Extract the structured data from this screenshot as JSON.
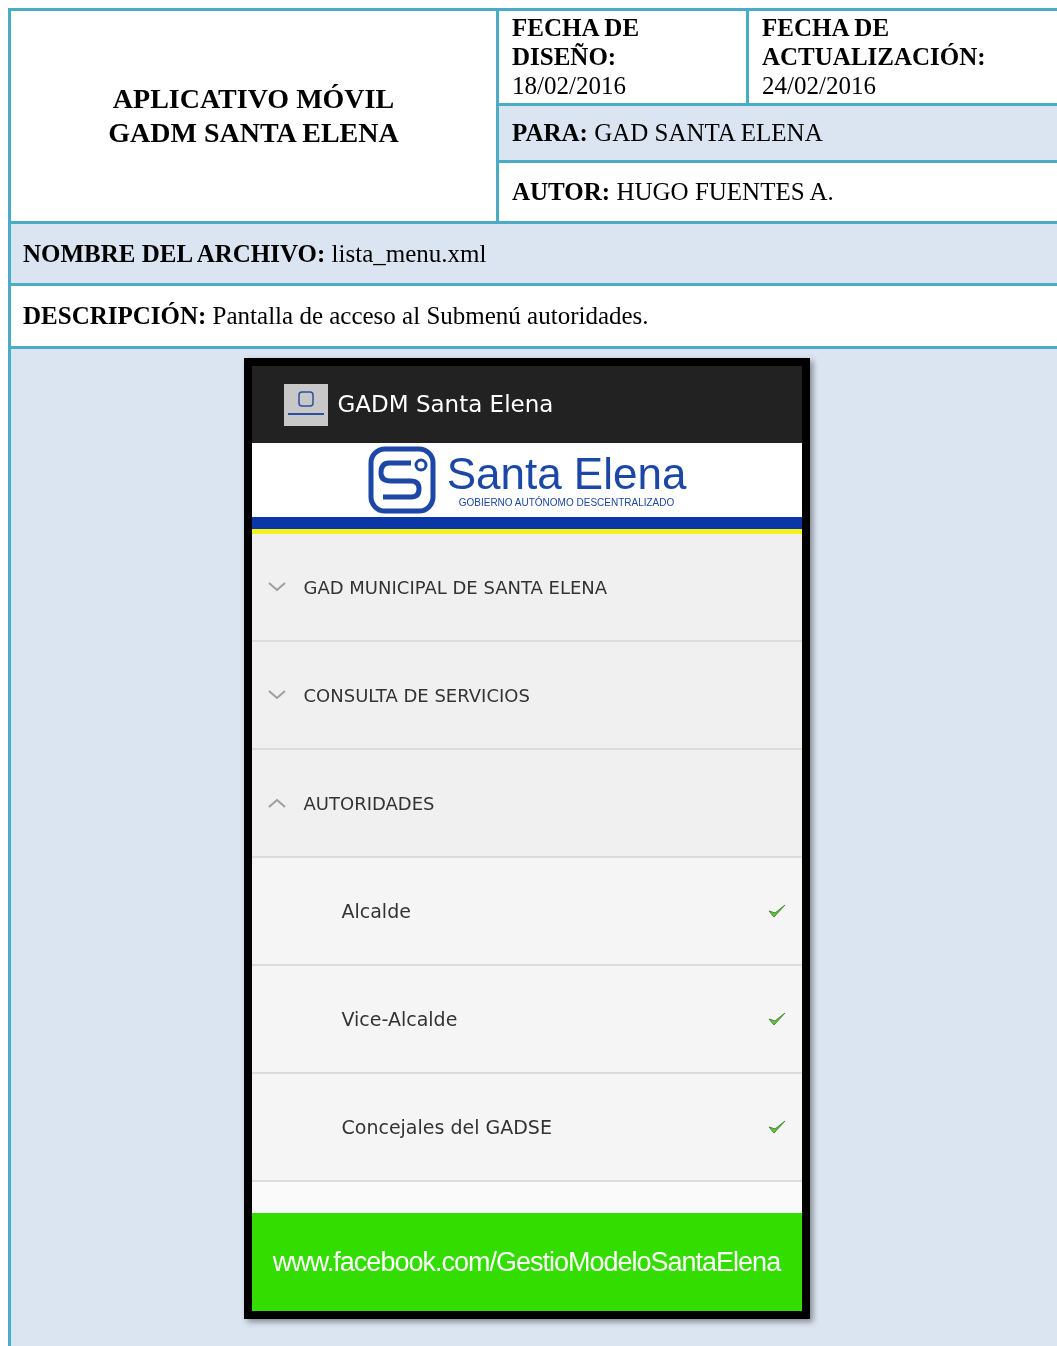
{
  "header": {
    "title_lines": [
      "APLICATIVO MÓVIL",
      "GADM SANTA ELENA"
    ],
    "design_date": {
      "label": "FECHA DE DISEÑO:",
      "value": "18/02/2016"
    },
    "update_date": {
      "label": "FECHA DE ACTUALIZACIÓN:",
      "value": "24/02/2016"
    },
    "for": "**PARA:** GAD SANTA ELENA",
    "author": "**AUTOR:** HUGO FUENTES A."
  },
  "file_name": "**NOMBRE DEL ARCHIVO:** lista_menu.xml",
  "description": "**DESCRIPCIÓN:** Pantalla de acceso al Submenú autoridades.",
  "app": {
    "title": "GADM Santa Elena",
    "logo": {
      "name": "Santa Elena",
      "subtitle": "GOBIERNO AUTÓNOMO DESCENTRALIZADO"
    },
    "menu": [
      {
        "label": "GAD MUNICIPAL DE SANTA ELENA",
        "expanded": false
      },
      {
        "label": "CONSULTA DE SERVICIOS",
        "expanded": false
      },
      {
        "label": "AUTORIDADES",
        "expanded": true,
        "children": [
          {
            "label": "Alcalde",
            "checked": true
          },
          {
            "label": "Vice-Alcalde",
            "checked": true
          },
          {
            "label": "Concejales del GADSE",
            "checked": true
          }
        ]
      }
    ],
    "footer": "www.facebook.com/GestioModeloSantaElena"
  }
}
